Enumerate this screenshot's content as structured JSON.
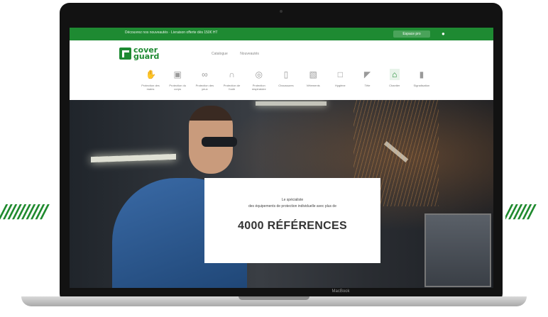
{
  "colors": {
    "brand_green": "#1e8a32",
    "laptop_bezel": "#121212"
  },
  "topbar": {
    "message": "Découvrez nos nouveautés · Livraison offerte dès 150€ HT",
    "button_label": "Espace pro",
    "user_icon": "user-icon"
  },
  "logo": {
    "line1": "cover",
    "line2": "guard"
  },
  "nav": {
    "links": [
      "Catalogue",
      "Nouveautés"
    ]
  },
  "categories": [
    {
      "label": "Protection des mains",
      "icon": "glove-icon"
    },
    {
      "label": "Protection du corps",
      "icon": "shirt-icon"
    },
    {
      "label": "Protection des yeux",
      "icon": "glasses-icon"
    },
    {
      "label": "Protection de l'ouïe",
      "icon": "ear-icon"
    },
    {
      "label": "Protection respiratoire",
      "icon": "mask-icon"
    },
    {
      "label": "Chaussures",
      "icon": "boot-icon"
    },
    {
      "label": "Vêtements",
      "icon": "jacket-icon"
    },
    {
      "label": "Hygiène",
      "icon": "box-icon"
    },
    {
      "label": "Tête",
      "icon": "helmet-icon"
    },
    {
      "label": "Chantier",
      "icon": "home-icon"
    },
    {
      "label": "Signalisation",
      "icon": "bottle-icon"
    }
  ],
  "hero": {
    "line1": "Le spécialiste",
    "line2": "des équipements de protection individuelle avec plus de",
    "headline": "4000 RÉFÉRENCES"
  },
  "device": {
    "brand": "MacBook"
  },
  "decor": {
    "stripes_left": "//////////",
    "stripes_right": "//////"
  }
}
